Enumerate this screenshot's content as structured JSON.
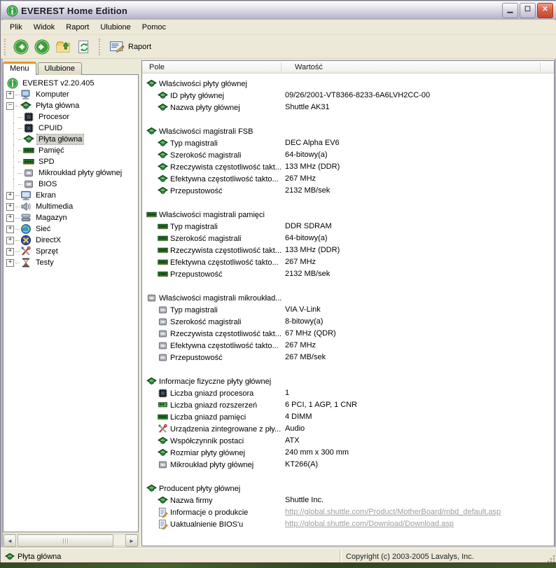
{
  "window": {
    "title": "EVEREST Home Edition"
  },
  "window_controls": {
    "minimize": "_",
    "maximize": "□",
    "close": "✕"
  },
  "menu_bar": {
    "items": [
      "Plik",
      "Widok",
      "Raport",
      "Ulubione",
      "Pomoc"
    ]
  },
  "toolbar": {
    "buttons": [
      {
        "icon": "back"
      },
      {
        "icon": "forward"
      },
      {
        "icon": "folder-up"
      },
      {
        "icon": "refresh"
      }
    ],
    "report_label": "Raport",
    "report_icon": "report"
  },
  "sidebar": {
    "tabs": [
      {
        "label": "Menu",
        "active": true
      },
      {
        "label": "Ulubione",
        "active": false
      }
    ],
    "tree": [
      {
        "label": "EVEREST v2.20.405",
        "icon": "info",
        "level": 0,
        "expander": ""
      },
      {
        "label": "Komputer",
        "icon": "computer",
        "level": 1,
        "expander": "+"
      },
      {
        "label": "Płyta główna",
        "icon": "mobo",
        "level": 1,
        "expander": "-"
      },
      {
        "label": "Procesor",
        "icon": "cpu",
        "level": 2,
        "expander": ""
      },
      {
        "label": "CPUID",
        "icon": "cpu",
        "level": 2,
        "expander": ""
      },
      {
        "label": "Płyta główna",
        "icon": "mobo",
        "level": 2,
        "expander": "",
        "selected": true
      },
      {
        "label": "Pamięć",
        "icon": "ram",
        "level": 2,
        "expander": ""
      },
      {
        "label": "SPD",
        "icon": "ram",
        "level": 2,
        "expander": ""
      },
      {
        "label": "Mikroukład płyty głównej",
        "icon": "chip",
        "level": 2,
        "expander": ""
      },
      {
        "label": "BIOS",
        "icon": "chip",
        "level": 2,
        "expander": ""
      },
      {
        "label": "Ekran",
        "icon": "display",
        "level": 1,
        "expander": "+"
      },
      {
        "label": "Multimedia",
        "icon": "audio",
        "level": 1,
        "expander": "+"
      },
      {
        "label": "Magazyn",
        "icon": "storage",
        "level": 1,
        "expander": "+"
      },
      {
        "label": "Sieć",
        "icon": "network",
        "level": 1,
        "expander": "+"
      },
      {
        "label": "DirectX",
        "icon": "directx",
        "level": 1,
        "expander": "+"
      },
      {
        "label": "Sprzęt",
        "icon": "tools",
        "level": 1,
        "expander": "+"
      },
      {
        "label": "Testy",
        "icon": "hourglass",
        "level": 1,
        "expander": "+"
      }
    ],
    "scrollbar": {
      "left_icon": "◄",
      "right_icon": "►"
    }
  },
  "main": {
    "columns": [
      "Pole",
      "Wartość"
    ],
    "sections": [
      {
        "icon": "mobo",
        "title": "Właściwości płyty głównej",
        "rows": [
          {
            "icon": "mobo",
            "field": "ID płyty głównej",
            "value": "09/26/2001-VT8366-8233-6A6LVH2CC-00"
          },
          {
            "icon": "mobo",
            "field": "Nazwa płyty głównej",
            "value": "Shuttle AK31"
          }
        ]
      },
      {
        "icon": "mobo",
        "title": "Właściwości magistrali FSB",
        "rows": [
          {
            "icon": "mobo",
            "field": "Typ magistrali",
            "value": "DEC Alpha EV6"
          },
          {
            "icon": "mobo",
            "field": "Szerokość magistrali",
            "value": "64-bitowy(a)"
          },
          {
            "icon": "mobo",
            "field": "Rzeczywista częstotliwość takt...",
            "value": "133 MHz (DDR)"
          },
          {
            "icon": "mobo",
            "field": "Efektywna częstotliwość takto...",
            "value": "267 MHz"
          },
          {
            "icon": "mobo",
            "field": "Przepustowość",
            "value": "2132 MB/sek"
          }
        ]
      },
      {
        "icon": "ram",
        "title": "Właściwości magistrali pamięci",
        "rows": [
          {
            "icon": "ram",
            "field": "Typ magistrali",
            "value": "DDR SDRAM"
          },
          {
            "icon": "ram",
            "field": "Szerokość magistrali",
            "value": "64-bitowy(a)"
          },
          {
            "icon": "ram",
            "field": "Rzeczywista częstotliwość takt...",
            "value": "133 MHz (DDR)"
          },
          {
            "icon": "ram",
            "field": "Efektywna częstotliwość takto...",
            "value": "267 MHz"
          },
          {
            "icon": "ram",
            "field": "Przepustowość",
            "value": "2132 MB/sek"
          }
        ]
      },
      {
        "icon": "chip",
        "title": "Właściwości magistrali mikroukład...",
        "rows": [
          {
            "icon": "chip",
            "field": "Typ magistrali",
            "value": "VIA V-Link"
          },
          {
            "icon": "chip",
            "field": "Szerokość magistrali",
            "value": "8-bitowy(a)"
          },
          {
            "icon": "chip",
            "field": "Rzeczywista częstotliwość takt...",
            "value": "67 MHz (QDR)"
          },
          {
            "icon": "chip",
            "field": "Efektywna częstotliwość takto...",
            "value": "267 MHz"
          },
          {
            "icon": "chip",
            "field": "Przepustowość",
            "value": "267 MB/sek"
          }
        ]
      },
      {
        "icon": "mobo",
        "title": "Informacje fizyczne płyty głównej",
        "rows": [
          {
            "icon": "cpu",
            "field": "Liczba gniazd procesora",
            "value": "1"
          },
          {
            "icon": "card",
            "field": "Liczba gniazd rozszerzeń",
            "value": "6 PCI, 1 AGP, 1 CNR"
          },
          {
            "icon": "ram",
            "field": "Liczba gniazd pamięci",
            "value": "4 DIMM"
          },
          {
            "icon": "tools",
            "field": "Urządzenia zintegrowane z pły...",
            "value": "Audio"
          },
          {
            "icon": "mobo",
            "field": "Współczynnik postaci",
            "value": "ATX"
          },
          {
            "icon": "mobo",
            "field": "Rozmiar płyty głównej",
            "value": "240 mm x 300 mm"
          },
          {
            "icon": "chip",
            "field": "Mikroukład płyty głównej",
            "value": "KT266(A)"
          }
        ]
      },
      {
        "icon": "mobo",
        "title": "Producent płyty głównej",
        "rows": [
          {
            "icon": "mobo",
            "field": "Nazwa firmy",
            "value": "Shuttle Inc."
          },
          {
            "icon": "pagelink",
            "field": "Informacje o produkcie",
            "value": "http://global.shuttle.com/Product/MotherBoard/mbd_default.asp",
            "link": true
          },
          {
            "icon": "pagelink",
            "field": "Uaktualnienie BIOS'u",
            "value": "http://global.shuttle.com/Download/Download.asp",
            "link": true
          }
        ]
      }
    ]
  },
  "status_bar": {
    "left": "Płyta główna",
    "left_icon": "mobo",
    "right": "Copyright (c) 2003-2005 Lavalys, Inc."
  }
}
